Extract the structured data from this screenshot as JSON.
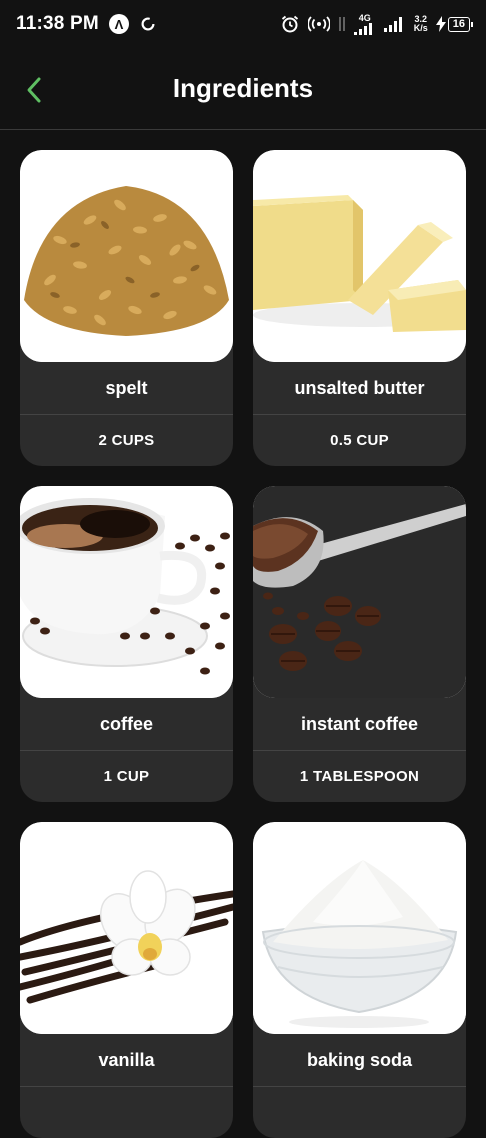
{
  "status_bar": {
    "time": "11:38 PM",
    "network": "4G",
    "speed_value": "3.2",
    "speed_unit": "K/s",
    "battery": "16"
  },
  "header": {
    "title": "Ingredients",
    "accent_color": "#4caf50"
  },
  "ingredients": [
    {
      "name": "spelt",
      "quantity": "2 CUPS",
      "image_icon": "spelt-grains-image"
    },
    {
      "name": "unsalted butter",
      "quantity": "0.5 CUP",
      "image_icon": "butter-image"
    },
    {
      "name": "coffee",
      "quantity": "1 CUP",
      "image_icon": "coffee-cup-image"
    },
    {
      "name": "instant coffee",
      "quantity": "1 TABLESPOON",
      "image_icon": "coffee-scoop-image"
    },
    {
      "name": "vanilla",
      "quantity": "",
      "image_icon": "vanilla-orchid-image"
    },
    {
      "name": "baking soda",
      "quantity": "",
      "image_icon": "baking-soda-bowl-image"
    }
  ]
}
